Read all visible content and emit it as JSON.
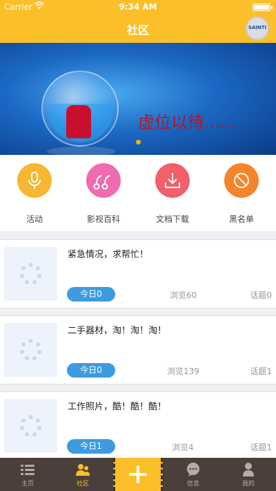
{
  "status_bar": {
    "carrier": "Carrier",
    "time": "9:34 AM"
  },
  "nav": {
    "title": "社区",
    "logo_text": "SAINTI"
  },
  "banner": {
    "caption": "虚位以待......"
  },
  "categories": [
    {
      "label": "活动",
      "icon": "microphone-icon",
      "color": "#f7b733"
    },
    {
      "label": "影视百科",
      "icon": "quote-icon",
      "color": "#f06bb1"
    },
    {
      "label": "文档下载",
      "icon": "download-icon",
      "color": "#f2606a"
    },
    {
      "label": "黑名单",
      "icon": "block-icon",
      "color": "#f7832b"
    }
  ],
  "posts": [
    {
      "title": "紧急情况，求帮忙！",
      "today": "今日0",
      "views": "浏览60",
      "topics": "话题0"
    },
    {
      "title": "二手器材，淘！淘！淘！",
      "today": "今日0",
      "views": "浏览139",
      "topics": "话题1"
    },
    {
      "title": "工作照片，酷！酷！酷！",
      "today": "今日1",
      "views": "浏览4",
      "topics": "话题1"
    }
  ],
  "tabs": [
    {
      "label": "主页",
      "icon": "list-icon"
    },
    {
      "label": "社区",
      "icon": "community-icon"
    },
    {
      "label": "信息",
      "icon": "chat-icon"
    },
    {
      "label": "我的",
      "icon": "person-icon"
    }
  ],
  "colors": {
    "accent": "#fbbf2a",
    "blue": "#3d9be0",
    "tab_bg": "#4a3f3b"
  }
}
